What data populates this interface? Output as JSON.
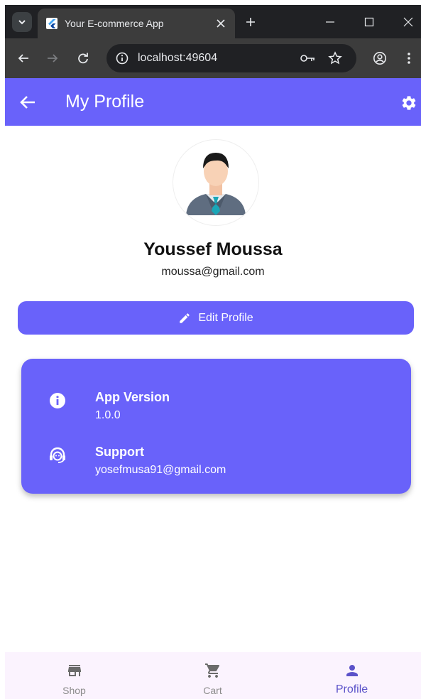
{
  "browser": {
    "tab_title": "Your E-commerce App",
    "url": "localhost:49604"
  },
  "appbar": {
    "title": "My Profile"
  },
  "profile": {
    "name": "Youssef Moussa",
    "email": "moussa@gmail.com",
    "edit_label": "Edit Profile"
  },
  "info": {
    "version_title": "App Version",
    "version_value": "1.0.0",
    "support_title": "Support",
    "support_value": "yosefmusa91@gmail.com"
  },
  "bottom_nav": {
    "items": [
      {
        "label": "Shop",
        "icon": "store-icon"
      },
      {
        "label": "Cart",
        "icon": "cart-icon"
      },
      {
        "label": "Profile",
        "icon": "person-icon",
        "active": true
      }
    ]
  },
  "colors": {
    "primary": "#6962fa",
    "bottom_nav_bg": "#fbf3fe",
    "active_nav": "#5b52c9"
  }
}
